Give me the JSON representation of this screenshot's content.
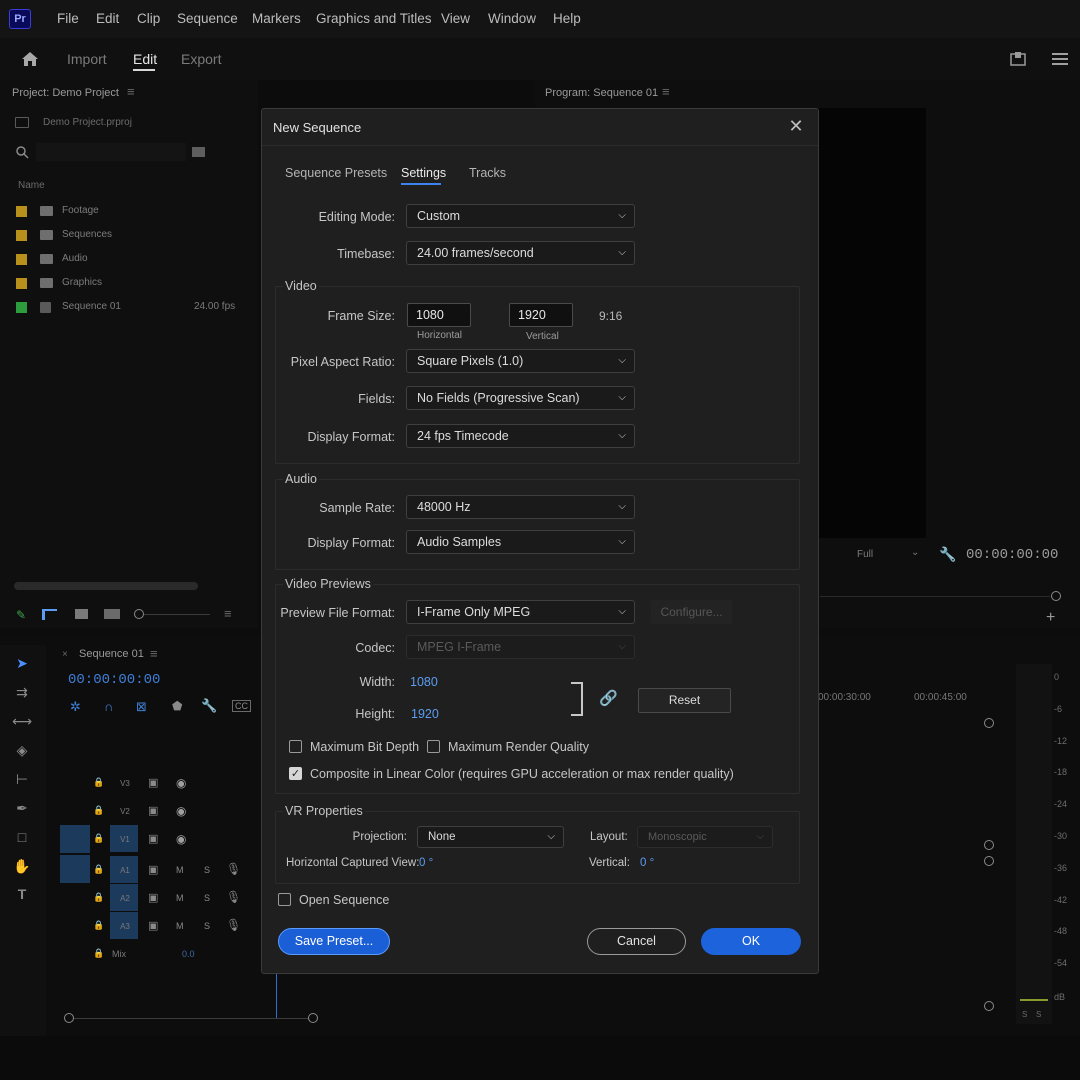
{
  "app": {
    "logo": "Pr"
  },
  "menu": [
    "File",
    "Edit",
    "Clip",
    "Sequence",
    "Markers",
    "Graphics and Titles",
    "View",
    "Window",
    "Help"
  ],
  "workspace": {
    "tabs": [
      "Import",
      "Edit",
      "Export"
    ]
  },
  "project": {
    "title": "Project: Demo Project",
    "file": "Demo Project.prproj",
    "column_name": "Name",
    "items": [
      {
        "label": "Footage",
        "color": "#b8901c"
      },
      {
        "label": "Sequences",
        "color": "#b8901c"
      },
      {
        "label": "Audio",
        "color": "#b8901c"
      },
      {
        "label": "Graphics",
        "color": "#b8901c"
      },
      {
        "label": "Sequence 01",
        "color": "#2c9c3c",
        "meta": "24.00 fps"
      }
    ]
  },
  "program": {
    "title": "Program: Sequence 01",
    "zoom": "Full",
    "timecode": "00:00:00:00"
  },
  "timeline": {
    "tab": "Sequence 01",
    "timecode": "00:00:00:00",
    "ruler": [
      "00:00:30:00",
      "00:00:45:00"
    ],
    "tracks_video": [
      "V3",
      "V2",
      "V1"
    ],
    "tracks_audio": [
      "A1",
      "A2",
      "A3"
    ],
    "mix_label": "Mix",
    "mix_value": "0.0",
    "meter_scale": [
      "0",
      "-6",
      "-12",
      "-18",
      "-24",
      "-30",
      "-36",
      "-42",
      "-48",
      "-54",
      "dB"
    ]
  },
  "dialog": {
    "title": "New Sequence",
    "tabs": [
      "Sequence Presets",
      "Settings",
      "Tracks"
    ],
    "editing_mode": {
      "label": "Editing Mode:",
      "value": "Custom"
    },
    "timebase": {
      "label": "Timebase:",
      "value": "24.00  frames/second"
    },
    "video": {
      "title": "Video",
      "frame_size_label": "Frame Size:",
      "horizontal": "1080",
      "horizontal_caption": "Horizontal",
      "vertical": "1920",
      "vertical_caption": "Vertical",
      "ratio": "9:16",
      "pixel_aspect": {
        "label": "Pixel Aspect Ratio:",
        "value": "Square Pixels (1.0)"
      },
      "fields": {
        "label": "Fields:",
        "value": "No Fields (Progressive Scan)"
      },
      "display_format": {
        "label": "Display Format:",
        "value": "24 fps Timecode"
      }
    },
    "audio": {
      "title": "Audio",
      "sample_rate": {
        "label": "Sample Rate:",
        "value": "48000 Hz"
      },
      "display_format": {
        "label": "Display Format:",
        "value": "Audio Samples"
      }
    },
    "previews": {
      "title": "Video Previews",
      "file_format": {
        "label": "Preview File Format:",
        "value": "I-Frame Only MPEG"
      },
      "configure": "Configure...",
      "codec": {
        "label": "Codec:",
        "value": "MPEG I-Frame"
      },
      "width": {
        "label": "Width:",
        "value": "1080"
      },
      "height": {
        "label": "Height:",
        "value": "1920"
      },
      "reset": "Reset",
      "max_bit_depth": "Maximum Bit Depth",
      "max_render_quality": "Maximum Render Quality",
      "composite_linear": "Composite in Linear Color (requires GPU acceleration or max render quality)"
    },
    "vr": {
      "title": "VR Properties",
      "projection": {
        "label": "Projection:",
        "value": "None"
      },
      "layout": {
        "label": "Layout:",
        "value": "Monoscopic"
      },
      "h_view": {
        "label": "Horizontal Captured View:",
        "value": "0 °"
      },
      "vertical": {
        "label": "Vertical:",
        "value": "0 °"
      }
    },
    "open_sequence": "Open Sequence",
    "save_preset": "Save Preset...",
    "cancel": "Cancel",
    "ok": "OK"
  },
  "colors": {
    "accent": "#1d63dc",
    "link_value": "#5b9df2"
  }
}
